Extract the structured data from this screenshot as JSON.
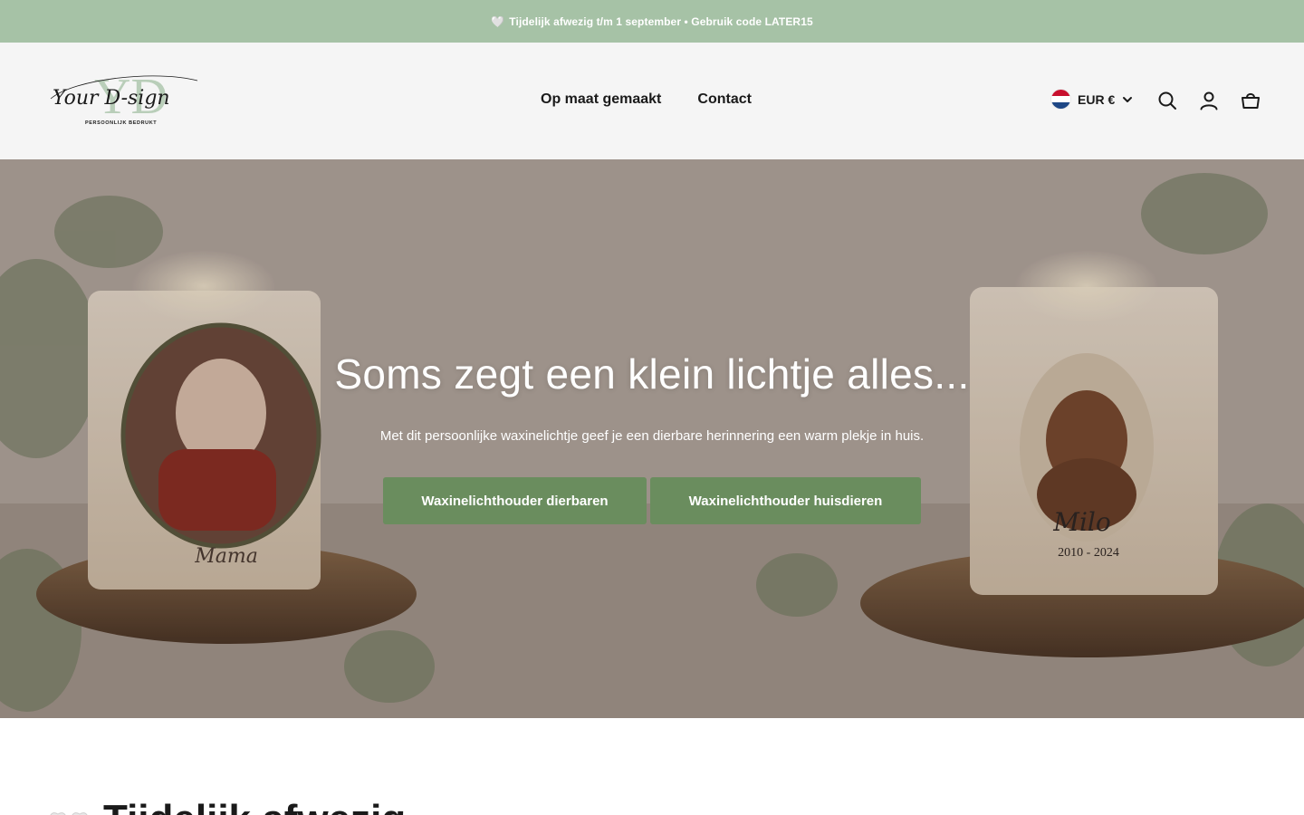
{
  "announcement": {
    "icon": "white-heart-icon",
    "text": "Tijdelijk afwezig t/m 1 september • Gebruik code LATER15"
  },
  "header": {
    "logo": {
      "monogram": "YD",
      "script": "Your D-sign",
      "tagline": "PERSOONLIJK BEDRUKT"
    },
    "nav": [
      {
        "label": "Op maat gemaakt"
      },
      {
        "label": "Contact"
      }
    ],
    "currency": {
      "flag": "netherlands-flag",
      "label": "EUR €"
    },
    "icons": [
      "search-icon",
      "account-icon",
      "cart-icon"
    ]
  },
  "hero": {
    "title": "Soms zegt een klein lichtje alles...",
    "subtitle": "Met dit persoonlijke waxinelichtje geef je een dierbare herinnering een warm plekje in huis.",
    "buttons": [
      {
        "label": "Waxinelichthouder dierbaren"
      },
      {
        "label": "Waxinelichthouder huisdieren"
      }
    ],
    "left_candle_caption": "Mama",
    "right_candle_caption": "Milo",
    "right_candle_years": "2010 - 2024"
  },
  "section": {
    "icon": "white-hearts-icon",
    "heading": "Tijdelijk afwezig ..."
  },
  "colors": {
    "announcement_bg": "#a6c2a6",
    "header_bg": "#f5f5f5",
    "button_bg": "#6a8d5e",
    "text": "#1a1a1a"
  }
}
